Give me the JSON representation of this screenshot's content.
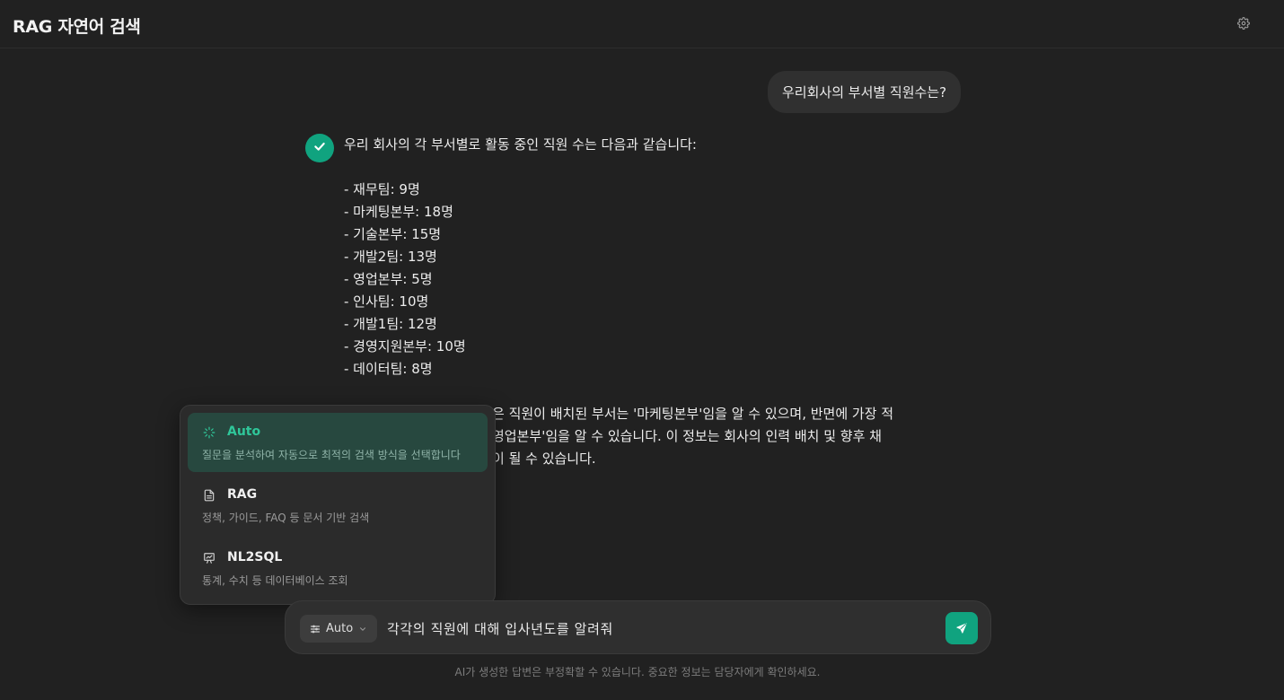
{
  "header": {
    "title": "RAG 자연어 검색",
    "settings_icon": "gear-icon"
  },
  "conversation": {
    "user_message": "우리회사의 부서별 직원수는?",
    "assistant": {
      "intro": "우리 회사의 각 부서별로 활동 중인 직원 수는 다음과 같습니다:",
      "departments": [
        "- 재무팀: 9명",
        "- 마케팅본부: 18명",
        "- 기술본부: 15명",
        "- 개발2팀: 13명",
        "- 영업본부: 5명",
        "- 인사팀: 10명",
        "- 개발1팀: 12명",
        "- 경영지원본부: 10명",
        "- 데이터팀: 8명"
      ],
      "summary_lines": [
        "은 직원이 배치된 부서는 '마케팅본부'임을 알 수 있으며, 반면에 가장 적",
        "영업본부'임을 알 수 있습니다. 이 정보는 회사의 인력 배치 및 향후 채",
        "이 될 수 있습니다."
      ]
    }
  },
  "mode_menu": {
    "options": [
      {
        "name": "Auto",
        "description": "질문을 분석하여 자동으로 최적의 검색 방식을 선택합니다",
        "icon": "sparkle-icon",
        "selected": true
      },
      {
        "name": "RAG",
        "description": "정책, 가이드, FAQ 등 문서 기반 검색",
        "icon": "document-icon",
        "selected": false
      },
      {
        "name": "NL2SQL",
        "description": "통계, 수치 등 데이터베이스 조회",
        "icon": "chart-icon",
        "selected": false
      }
    ]
  },
  "input": {
    "mode_label": "Auto",
    "value": "각각의 직원에 대해 입사년도를 알려줘",
    "send_icon": "send-icon"
  },
  "disclaimer": "AI가 생성한 답변은 부정확할 수 있습니다. 중요한 정보는 담당자에게 확인하세요.",
  "colors": {
    "background": "#212121",
    "accent": "#10a37f",
    "selected_option_bg": "#27483f",
    "bubble_bg": "#303030"
  }
}
